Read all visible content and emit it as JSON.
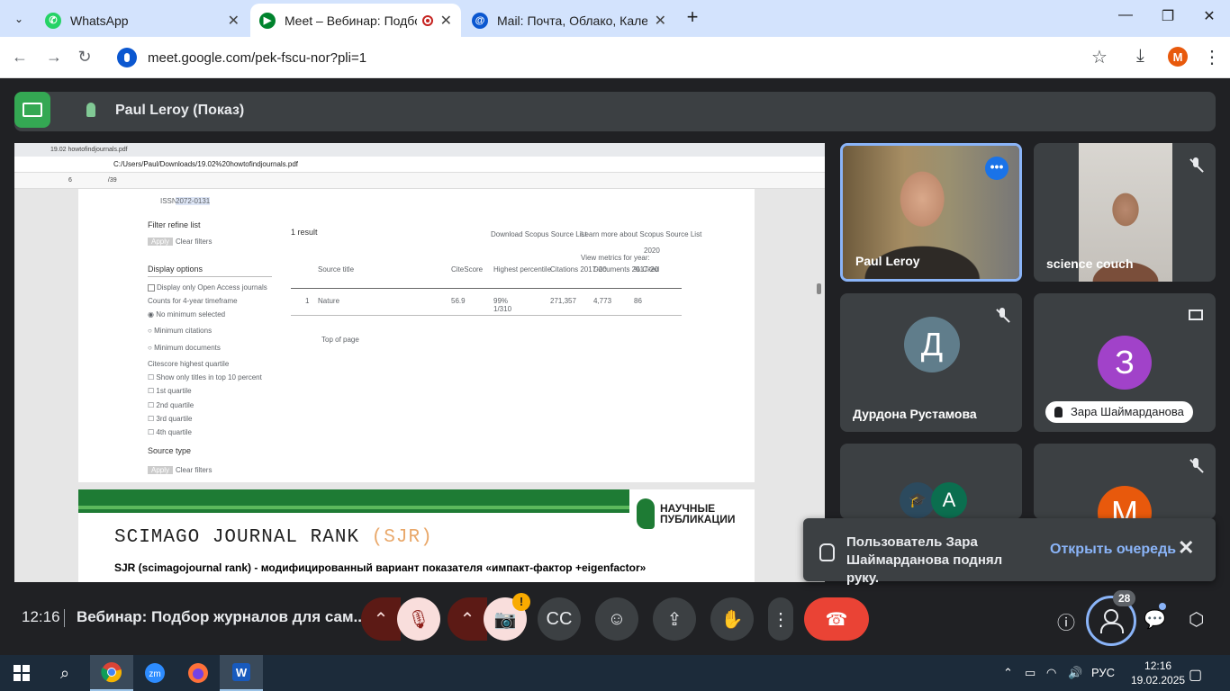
{
  "browser": {
    "tabs": [
      {
        "title": "WhatsApp",
        "fav_color": "#25d366"
      },
      {
        "title": "Meet – Вебинар: Подбор ж",
        "fav_color": "#00832d"
      },
      {
        "title": "Mail: Почта, Облако, Календар",
        "fav_color": "#0b57d0"
      }
    ],
    "url": "meet.google.com/pek-fscu-nor?pli=1",
    "profile_initial": "M"
  },
  "presentation": {
    "presenter_label": "Paul Leroy (Показ)",
    "pdf": {
      "tab_title": "19.02 howtofindjournals.pdf",
      "path": "C:/Users/Paul/Downloads/19.02%20howtofindjournals.pdf",
      "page_field": "6",
      "page_total": "/39",
      "sidebar": {
        "issn_label": "ISSN:",
        "issn_value": "2072-0131",
        "filter_title": "Filter refine list",
        "apply": "Apply",
        "clear": "Clear filters",
        "display_options": "Display options",
        "open_access": "Display only Open Access journals",
        "counts_label": "Counts for 4-year timeframe",
        "radio_1": "No minimum selected",
        "radio_2": "Minimum citations",
        "radio_3": "Minimum documents",
        "quartile_label": "Citescore highest quartile",
        "q_options": [
          "Show only titles in top 10 percent",
          "1st quartile",
          "2nd quartile",
          "3rd quartile",
          "4th quartile"
        ],
        "source_type": "Source type",
        "apply2": "Apply",
        "clear2": "Clear filters"
      },
      "results": {
        "count": "1 result",
        "download": "Download Scopus Source List",
        "learn_more": "Learn more about Scopus Source List",
        "view_metrics": "View metrics for year:",
        "year": "2020",
        "columns": [
          "Source title",
          "CiteScore",
          "Highest percentile",
          "Citations 2017-20",
          "Documents 2017-20",
          "% Cited"
        ],
        "row": {
          "num": "1",
          "title": "Nature",
          "citescore": "56.9",
          "percentile": "99%",
          "percentile_sub": "1/310",
          "citations": "271,357",
          "documents": "4,773",
          "cited": "86"
        },
        "top_of_page": "Top of page"
      }
    },
    "slide2": {
      "title": "SCIMAGO JOURNAL RANK",
      "acronym": "(SJR)",
      "subtitle": "SJR (scimagojournal rank) - модифицированный вариант показателя «импакт-фактор +eigenfactor»",
      "logo_line1": "НАУЧНЫЕ",
      "logo_line2": "ПУБЛИКАЦИИ"
    }
  },
  "participants": [
    {
      "name": "Paul Leroy",
      "type": "video",
      "active": true
    },
    {
      "name": "science couch",
      "type": "video",
      "muted": true
    },
    {
      "name": "Дурдона Рустамова",
      "initial": "Д",
      "color": "#607d8b",
      "muted": true
    },
    {
      "name": "Зара Шаймарданова",
      "initial": "З",
      "color": "#a142c9",
      "hand_raised": true
    },
    {
      "name": "",
      "initial": "А",
      "color": "#0b6e4f"
    },
    {
      "name": "",
      "initial": "М",
      "color": "#e8590c",
      "muted": true
    }
  ],
  "notification": {
    "message": "Пользователь Зара Шаймарданова поднял руку.",
    "action": "Открыть очередь"
  },
  "controls": {
    "time": "12:16",
    "meeting_title": "Вебинар: Подбор журналов для сам...",
    "people_count": "28",
    "warning": "!"
  },
  "taskbar": {
    "lang": "РУС",
    "clock_time": "12:16",
    "clock_date": "19.02.2025"
  }
}
